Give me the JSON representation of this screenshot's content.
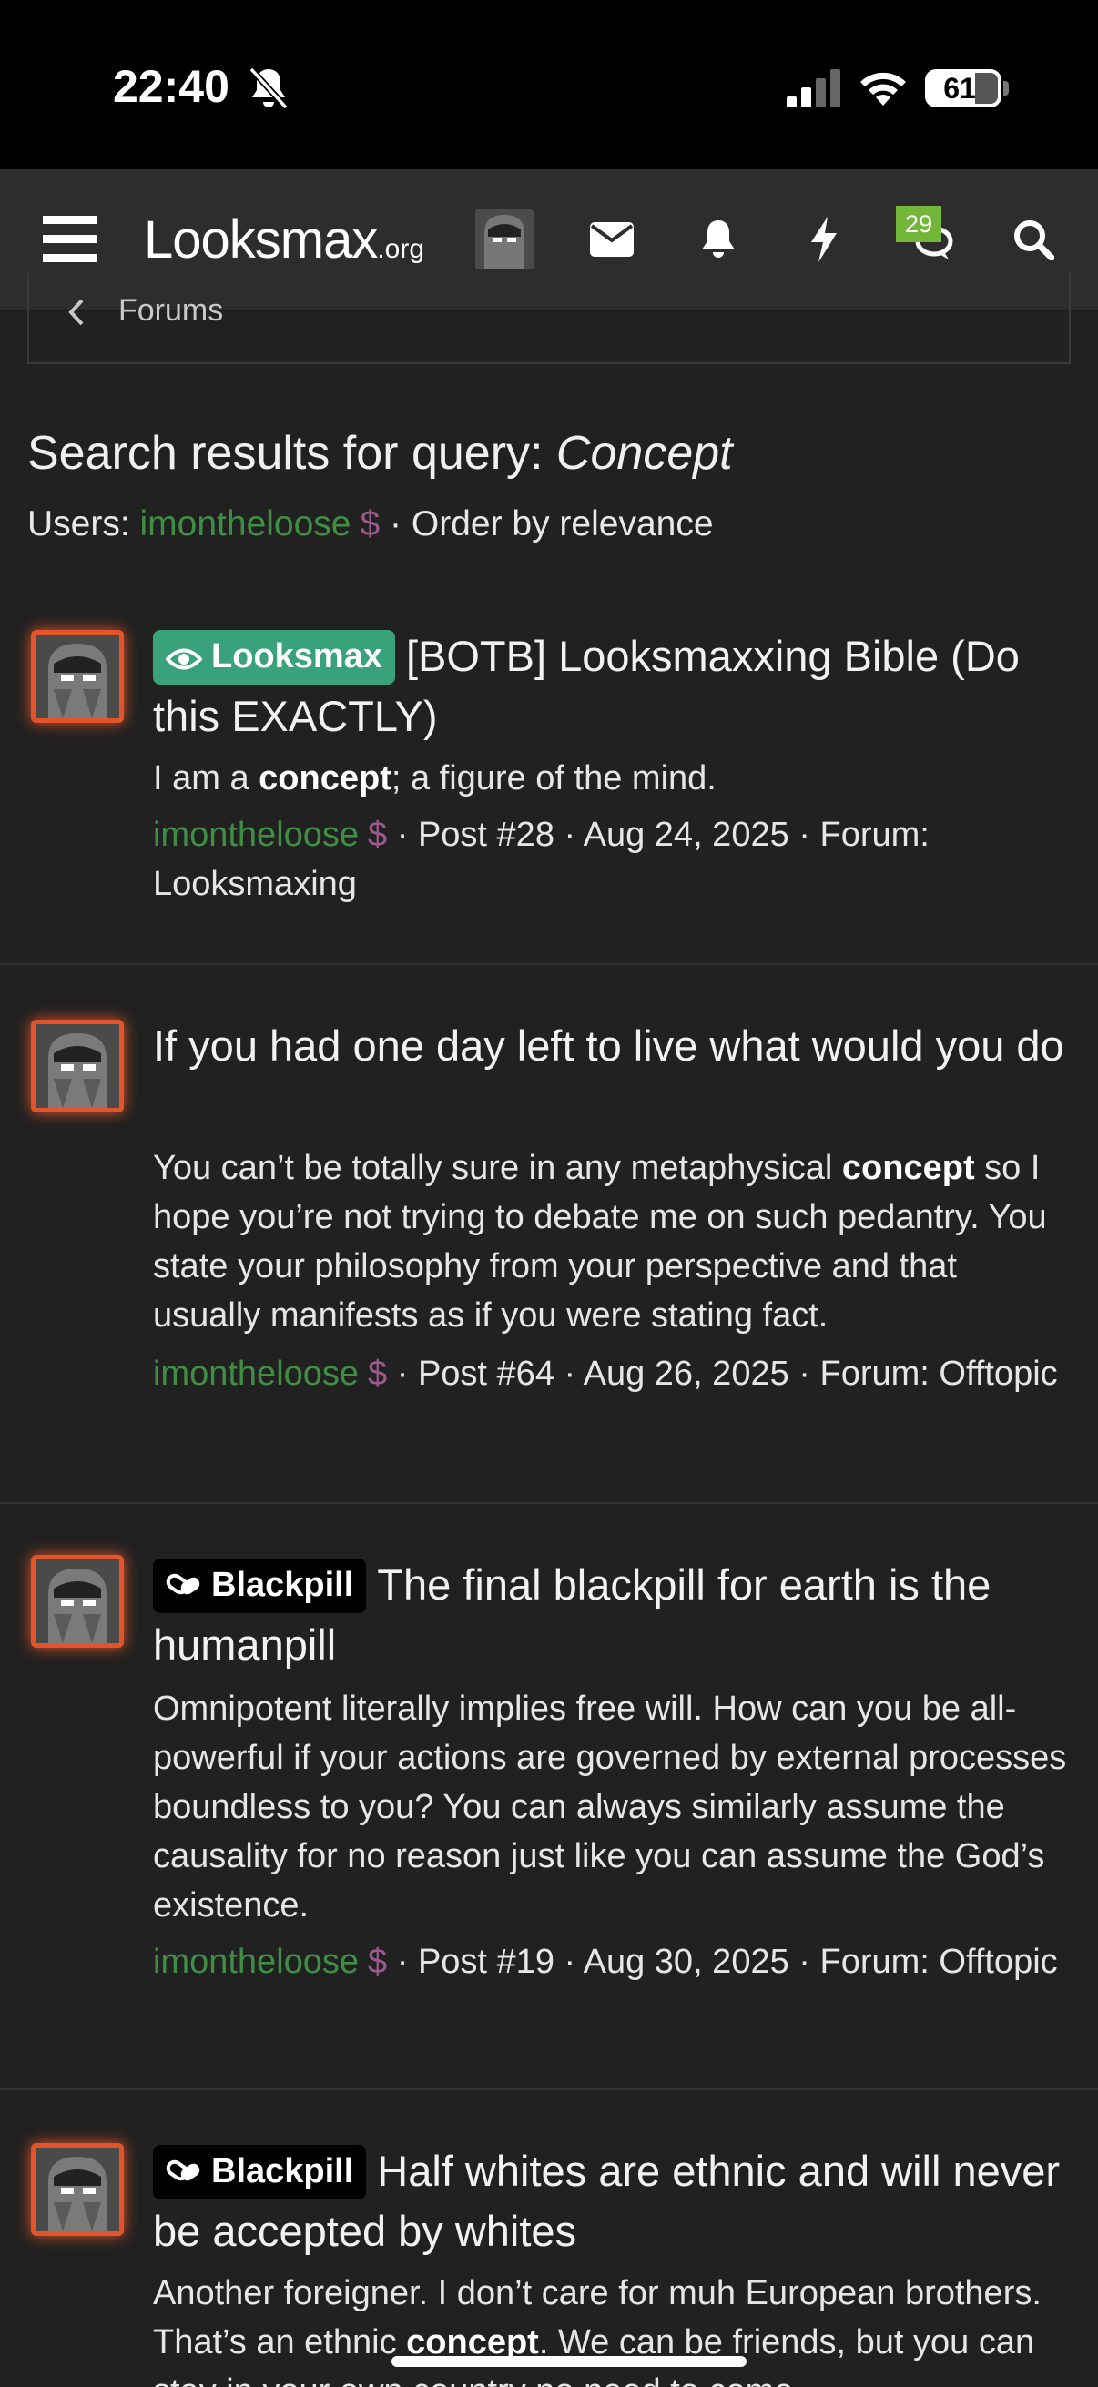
{
  "status_bar": {
    "time": "22:40",
    "battery": "61",
    "battery_level": 0.61,
    "icons": [
      "bell-slash-icon",
      "signal-icon",
      "wifi-icon",
      "battery-icon"
    ]
  },
  "navbar": {
    "logo_main": "Looksmax",
    "logo_suffix": ".org",
    "conversations_badge": "29",
    "icons": [
      "menu-icon",
      "avatar",
      "envelope-icon",
      "bell-icon",
      "bolt-icon",
      "conversations-icon",
      "search-icon"
    ]
  },
  "breadcrumb": {
    "label": "Forums"
  },
  "heading": {
    "title_prefix": "Search results for query: ",
    "query": "Concept",
    "users_label": "Users: ",
    "username": "imontheloose",
    "dollar": "$",
    "order_text": " · Order by relevance"
  },
  "results": [
    {
      "prefix": "Looksmax",
      "prefix_icon": "eye-icon",
      "title": "[BOTB] Looksmaxxing Bible (Do this EXACTLY)",
      "snippet_before": "I am a ",
      "snippet_bold": "concept",
      "snippet_after": "; a figure of the mind.",
      "author": "imontheloose",
      "dollar": "$",
      "meta": " · Post #28 · Aug 24, 2025 · Forum: Looksmaxing"
    },
    {
      "prefix": "",
      "title": "If you had one day left to live what would you do",
      "snippet_before": "You can’t be totally sure in any metaphysical ",
      "snippet_bold": "concept",
      "snippet_after": " so I hope you’re not trying to debate me on such pedantry. You state your philosophy from your perspective and that usually manifests as if you were stating fact.",
      "author": "imontheloose",
      "dollar": "$",
      "meta": " · Post #64 · Aug 26, 2025 · Forum: Offtopic"
    },
    {
      "prefix": "Blackpill",
      "prefix_icon": "pill-icon",
      "title": "The final blackpill for earth is the humanpill",
      "snippet_before": "Omnipotent literally implies free will. How can you be all-powerful if your actions are governed by external processes boundless to you? You can always similarly assume the causality for no reason just like you can assume the God’s existence.",
      "snippet_bold": "",
      "snippet_after": "",
      "author": "imontheloose",
      "dollar": "$",
      "meta": " · Post #19 · Aug 30, 2025 · Forum: Offtopic"
    },
    {
      "prefix": "Blackpill",
      "prefix_icon": "pill-icon",
      "title": "Half whites are ethnic and will never be accepted by whites",
      "snippet_before": "Another foreigner. I don’t care for muh European brothers. That’s an ethnic ",
      "snippet_bold": "concept",
      "snippet_after": ". We can be friends, but you can stay in your own country no need to come",
      "author": "",
      "dollar": "",
      "meta": ""
    }
  ],
  "colors": {
    "background": "#212121",
    "navbar": "#2d2d2d",
    "username": "#3f8e44",
    "looksmax_prefix": "#3aa27a",
    "avatar_glow": "#e2552a",
    "badge": "#73b63a"
  }
}
